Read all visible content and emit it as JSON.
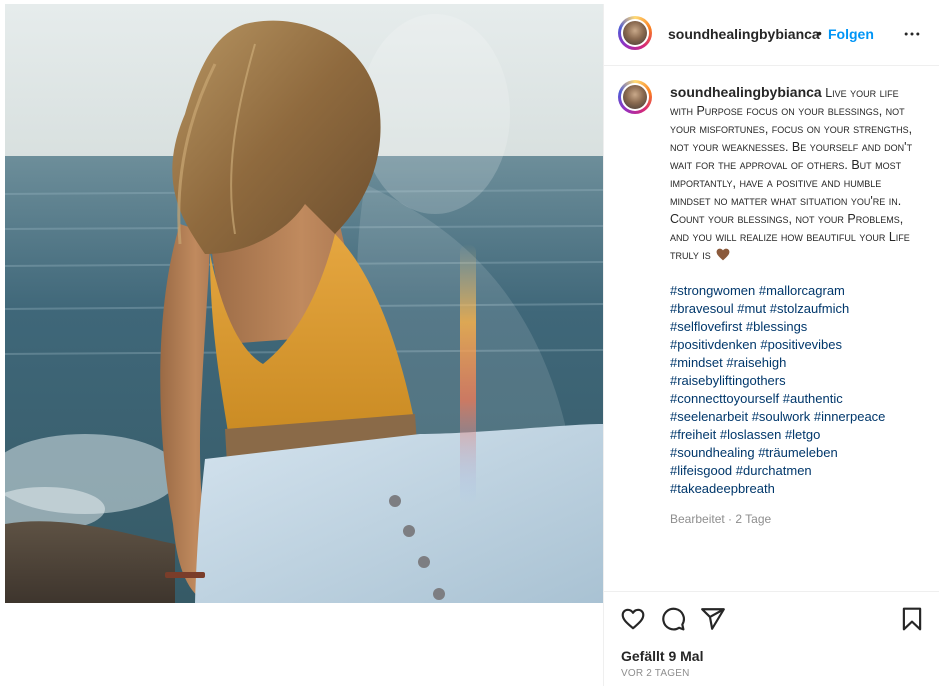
{
  "post": {
    "username": "soundhealingbybianca",
    "separator": "•",
    "follow_label": "Folgen",
    "more_icon": "more-horizontal-icon"
  },
  "caption": {
    "username": "soundhealingbybianca",
    "text": "Live your life with Purpose focus on your blessings, not your misfortunes, focus on your strengths, not your weaknesses. Be yourself and don't wait for the approval of others. But most importantly, have a positive and humble mindset no matter what situation you're in. Count your blessings, not your Problems, and you will realize how beautiful your Life truly is",
    "emoji": "brown-heart-icon",
    "hashtag_lines": [
      [
        "#strongwomen",
        "#mallorcagram"
      ],
      [
        "#bravesoul",
        "#mut",
        "#stolzaufmich"
      ],
      [
        "#selflovefirst",
        "#blessings"
      ],
      [
        "#positivdenken",
        "#positivevibes"
      ],
      [
        "#mindset",
        "#raisehigh"
      ],
      [
        "#raisebyliftingothers"
      ],
      [
        "#connecttoyourself",
        "#authentic"
      ],
      [
        "#seelenarbeit",
        "#soulwork",
        "#innerpeace"
      ],
      [
        "#freiheit",
        "#loslassen",
        "#letgo"
      ],
      [
        "#soundhealing",
        "#träumeleben"
      ],
      [
        "#lifeisgood",
        "#durchatmen"
      ],
      [
        "#takeadeepbreath"
      ]
    ],
    "edited": "Bearbeitet · 2 Tage"
  },
  "actions": {
    "icons": [
      "heart-icon",
      "comment-icon",
      "share-icon",
      "bookmark-icon"
    ],
    "likes": "Gefällt 9 Mal",
    "date": "VOR 2 TAGEN"
  },
  "colors": {
    "link": "#00376b",
    "follow": "#0095f6",
    "muted": "#8e8e8e",
    "heart_emoji": "#8b5a3c"
  }
}
